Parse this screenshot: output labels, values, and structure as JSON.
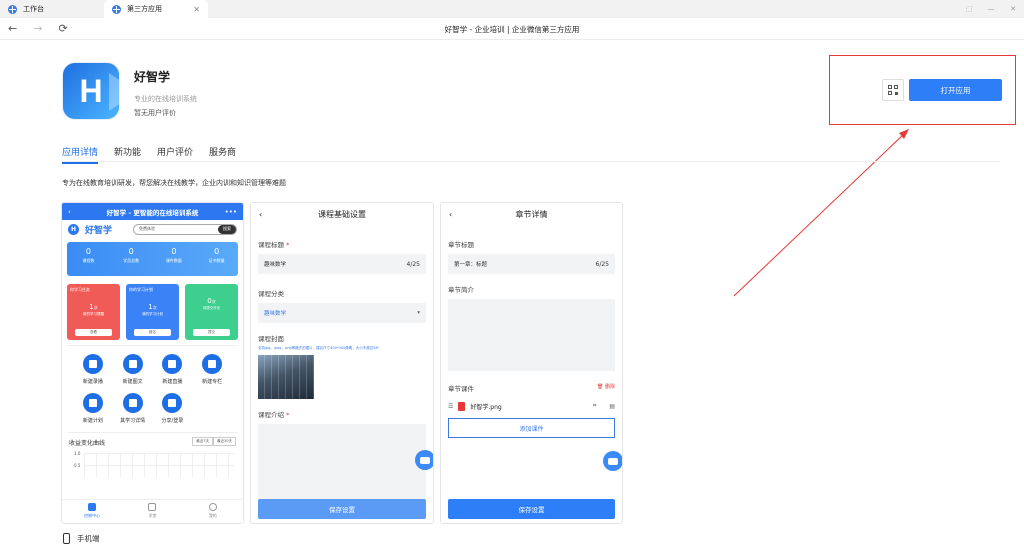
{
  "tabs": [
    {
      "label": "工作台"
    },
    {
      "label": "第三方应用"
    }
  ],
  "window_title": "好智学 - 企业培训 | 企业微信第三方应用",
  "nav": {
    "back": "←",
    "forward": "→",
    "refresh": "⟳"
  },
  "app": {
    "logo_letter": "H",
    "name": "好智学",
    "subtitle": "专业的在线培训系统",
    "rating": "暂无用户评价"
  },
  "actions": {
    "open_label": "打开应用"
  },
  "detail_tabs": [
    "应用详情",
    "新功能",
    "用户评价",
    "服务商"
  ],
  "description": "专为在线教育培训研发，帮您解决在线教学，企业内训和知识管理等难题",
  "screens": {
    "s1": {
      "back": "‹",
      "header": "好智学 - 更智能的在线培训系统",
      "menu": "•••",
      "brand": "好智学",
      "search_placeholder": "免费体验",
      "search_btn": "搜索",
      "stats": [
        {
          "n": "0",
          "l": "课程数"
        },
        {
          "n": "0",
          "l": "学员总数"
        },
        {
          "n": "0",
          "l": "课件数量"
        },
        {
          "n": "0",
          "l": "证书数量"
        }
      ],
      "cards": [
        {
          "title": "你学习任务",
          "num": "1",
          "unit": "次",
          "label": "新的学习提醒",
          "btn": "查看"
        },
        {
          "title": "你的学习计划",
          "num": "1",
          "unit": "次",
          "label": "我的学习计划",
          "btn": "报名"
        },
        {
          "title": "",
          "num": "0",
          "unit": "次",
          "label": "待提交作业",
          "btn": "提交"
        }
      ],
      "grid": [
        "新建录播",
        "新建图文",
        "新建直播",
        "新建专栏",
        "新建计划",
        "其学习详情",
        "分享/登录"
      ],
      "chart": {
        "title": "收益变化曲线",
        "btn1": "最近7天",
        "btn2": "最近30天",
        "y1": "1.0",
        "y2": "0.5"
      },
      "bottom_nav": [
        "控制中心",
        "学堂",
        "我的"
      ]
    },
    "s2": {
      "back": "‹",
      "title": "课程基础设置",
      "f_title_label": "课程标题",
      "f_title_value": "趣味数学",
      "f_title_count": "4/25",
      "f_cat_label": "课程分类",
      "f_cat_value": "趣味数学",
      "f_cover_label": "课程封面",
      "f_cover_hint": "支持jpg、jpeg、png等格式的图片，建议尺寸400*300像素，大小不超过5M",
      "f_intro_label": "课程介绍",
      "save": "保存设置"
    },
    "s3": {
      "back": "‹",
      "title": "章节详情",
      "f_title_label": "章节标题",
      "f_title_value": "第一章：标题",
      "f_title_count": "6/25",
      "f_intro_label": "章节简介",
      "f_files_label": "章节课件",
      "delete": "删除",
      "file_name": "好智学.png",
      "add_course": "添加课件",
      "save": "保存设置"
    }
  },
  "footer": {
    "mobile": "手机端"
  },
  "colors": {
    "accent": "#2d7ef7",
    "highlight": "#e53935"
  }
}
